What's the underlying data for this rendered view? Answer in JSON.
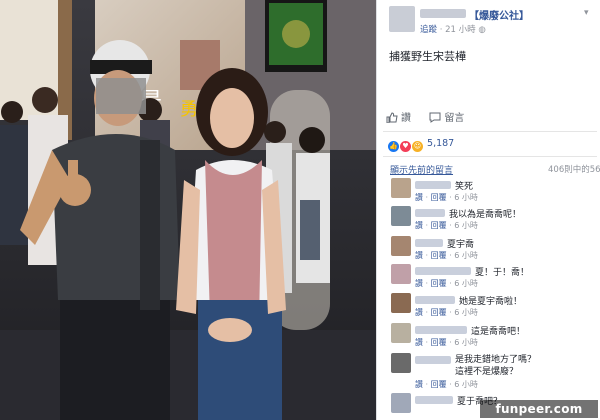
{
  "photo": {
    "poster_lines": [
      "是",
      "勇"
    ],
    "tv_visible": true
  },
  "post": {
    "page_name": "【爆廢公社】",
    "time": "21 小時",
    "follow_label": "追蹤",
    "text": "捕獲野生宋芸樺",
    "like_label": "讚",
    "comment_label": "留言",
    "reaction_count": "5,187",
    "previous_comments_label": "顯示先前的留言",
    "comment_count": "406則中的56"
  },
  "comments": [
    {
      "text": "笑死",
      "time": "6 小時"
    },
    {
      "text": "我以為是喬喬呢！",
      "time": "6 小時"
    },
    {
      "text": "夏宇喬",
      "time": "6 小時"
    },
    {
      "text": "夏！于！喬！",
      "time": "6 小時"
    },
    {
      "text": "她是夏宇喬啦！",
      "time": "6 小時"
    },
    {
      "text": "這是喬喬吧！",
      "time": "6 小時"
    },
    {
      "text": "是我走錯地方了嗎？\n這裡不是爆廢？",
      "time": "6 小時"
    },
    {
      "text": "夏于喬吧？",
      "time": ""
    }
  ],
  "comment_actions": {
    "like": "讚",
    "reply": "回覆"
  },
  "colors": {
    "link": "#365899",
    "meta": "#90949c",
    "text": "#1d2129",
    "like_blue": "#1877f2",
    "love_red": "#f33e58",
    "haha_yellow": "#f7b125"
  },
  "watermark": "funpeer.com"
}
